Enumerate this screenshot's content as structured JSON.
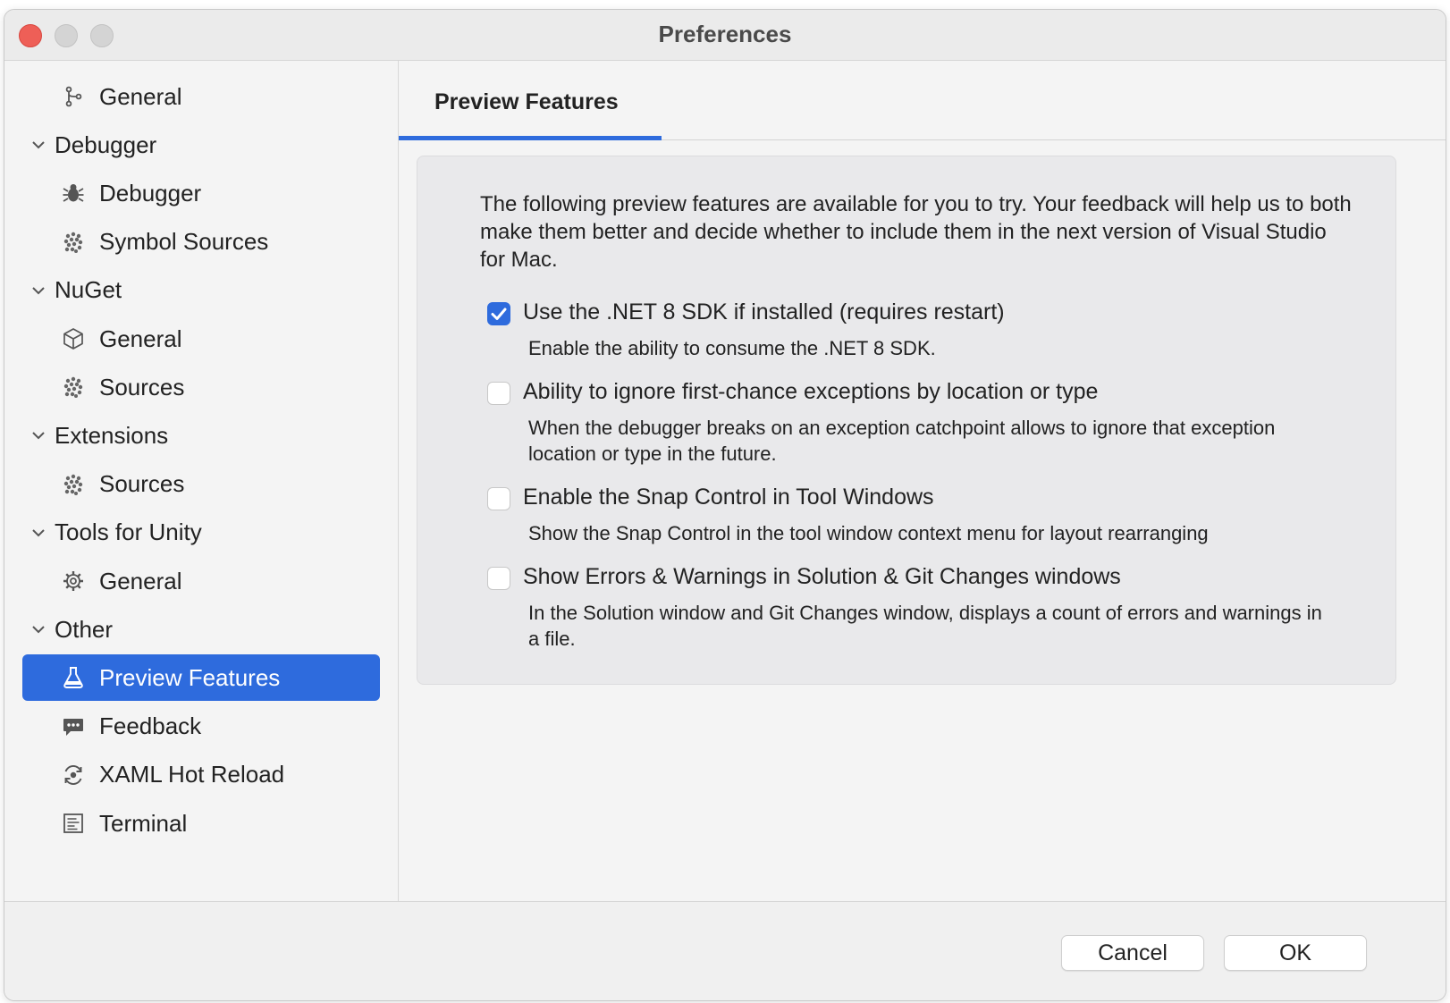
{
  "window": {
    "title": "Preferences"
  },
  "sidebar": {
    "items": [
      {
        "kind": "child",
        "label": "General",
        "icon": "branch-icon"
      },
      {
        "kind": "group",
        "label": "Debugger"
      },
      {
        "kind": "child",
        "label": "Debugger",
        "icon": "bug-icon"
      },
      {
        "kind": "child",
        "label": "Symbol Sources",
        "icon": "package-icon"
      },
      {
        "kind": "group",
        "label": "NuGet"
      },
      {
        "kind": "child",
        "label": "General",
        "icon": "cube-icon"
      },
      {
        "kind": "child",
        "label": "Sources",
        "icon": "package-icon"
      },
      {
        "kind": "group",
        "label": "Extensions"
      },
      {
        "kind": "child",
        "label": "Sources",
        "icon": "package-icon"
      },
      {
        "kind": "group",
        "label": "Tools for Unity"
      },
      {
        "kind": "child",
        "label": "General",
        "icon": "gear-icon"
      },
      {
        "kind": "group",
        "label": "Other"
      },
      {
        "kind": "child",
        "label": "Preview Features",
        "icon": "flask-icon",
        "selected": true
      },
      {
        "kind": "child",
        "label": "Feedback",
        "icon": "chat-bubble-icon"
      },
      {
        "kind": "child",
        "label": "XAML Hot Reload",
        "icon": "hot-reload-icon"
      },
      {
        "kind": "child",
        "label": "Terminal",
        "icon": "terminal-icon"
      }
    ]
  },
  "main": {
    "tab": "Preview Features",
    "intro": "The following preview features are available for you to try. Your feedback will help us to both make them better and decide whether to include them in the next version of Visual Studio for Mac.",
    "features": [
      {
        "title": "Use the .NET 8 SDK if installed (requires restart)",
        "description": "Enable the ability to consume the .NET 8 SDK.",
        "checked": true
      },
      {
        "title": "Ability to ignore first-chance exceptions by location or type",
        "description": "When the debugger breaks on an exception catchpoint allows to ignore that exception location or type in the future.",
        "checked": false
      },
      {
        "title": "Enable the Snap Control in Tool Windows",
        "description": "Show the Snap Control in the tool window context menu for layout rearranging",
        "checked": false
      },
      {
        "title": "Show Errors & Warnings in Solution & Git Changes windows",
        "description": "In the Solution window and Git Changes window, displays a count of errors and warnings in a file.",
        "checked": false
      }
    ]
  },
  "footer": {
    "cancel_label": "Cancel",
    "ok_label": "OK"
  },
  "colors": {
    "accent": "#2e6bdd",
    "close": "#ee5f57"
  }
}
